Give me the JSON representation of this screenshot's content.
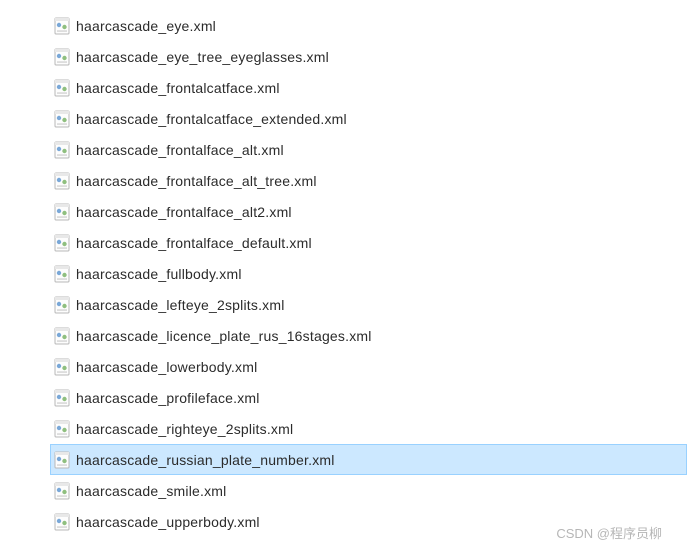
{
  "files": [
    {
      "name": "haarcascade_eye.xml",
      "selected": false
    },
    {
      "name": "haarcascade_eye_tree_eyeglasses.xml",
      "selected": false
    },
    {
      "name": "haarcascade_frontalcatface.xml",
      "selected": false
    },
    {
      "name": "haarcascade_frontalcatface_extended.xml",
      "selected": false
    },
    {
      "name": "haarcascade_frontalface_alt.xml",
      "selected": false
    },
    {
      "name": "haarcascade_frontalface_alt_tree.xml",
      "selected": false
    },
    {
      "name": "haarcascade_frontalface_alt2.xml",
      "selected": false
    },
    {
      "name": "haarcascade_frontalface_default.xml",
      "selected": false
    },
    {
      "name": "haarcascade_fullbody.xml",
      "selected": false
    },
    {
      "name": "haarcascade_lefteye_2splits.xml",
      "selected": false
    },
    {
      "name": "haarcascade_licence_plate_rus_16stages.xml",
      "selected": false
    },
    {
      "name": "haarcascade_lowerbody.xml",
      "selected": false
    },
    {
      "name": "haarcascade_profileface.xml",
      "selected": false
    },
    {
      "name": "haarcascade_righteye_2splits.xml",
      "selected": false
    },
    {
      "name": "haarcascade_russian_plate_number.xml",
      "selected": true
    },
    {
      "name": "haarcascade_smile.xml",
      "selected": false
    },
    {
      "name": "haarcascade_upperbody.xml",
      "selected": false
    }
  ],
  "watermark": "CSDN @程序员柳"
}
